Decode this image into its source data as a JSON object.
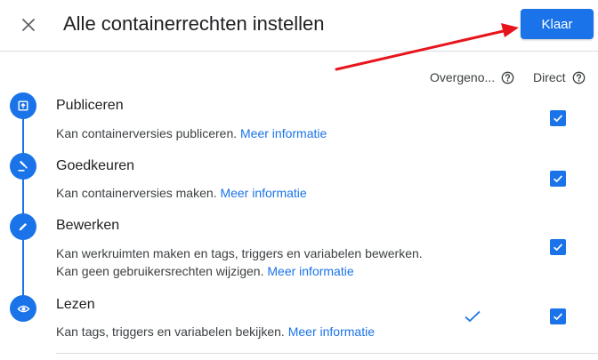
{
  "header": {
    "title": "Alle containerrechten instellen",
    "done_label": "Klaar"
  },
  "columns": {
    "inherited": "Overgeno...",
    "direct": "Direct"
  },
  "roles": [
    {
      "title": "Publiceren",
      "desc1": "Kan containerversies publiceren.",
      "link": "Meer informatie",
      "icon": "publish-icon",
      "direct_checked": true,
      "inherited_checked": false
    },
    {
      "title": "Goedkeuren",
      "desc1": "Kan containerversies maken.",
      "link": "Meer informatie",
      "icon": "gavel-icon",
      "direct_checked": true,
      "inherited_checked": false
    },
    {
      "title": "Bewerken",
      "desc1": "Kan werkruimten maken en tags, triggers en variabelen bewerken.",
      "desc2": "Kan geen gebruikersrechten wijzigen.",
      "link": "Meer informatie",
      "icon": "pencil-icon",
      "direct_checked": true,
      "inherited_checked": false
    },
    {
      "title": "Lezen",
      "desc1": "Kan tags, triggers en variabelen bekijken.",
      "link": "Meer informatie",
      "icon": "eye-icon",
      "direct_checked": true,
      "inherited_checked": true
    }
  ],
  "colors": {
    "accent": "#1a73e8",
    "annotation_arrow": "#e8141c"
  }
}
